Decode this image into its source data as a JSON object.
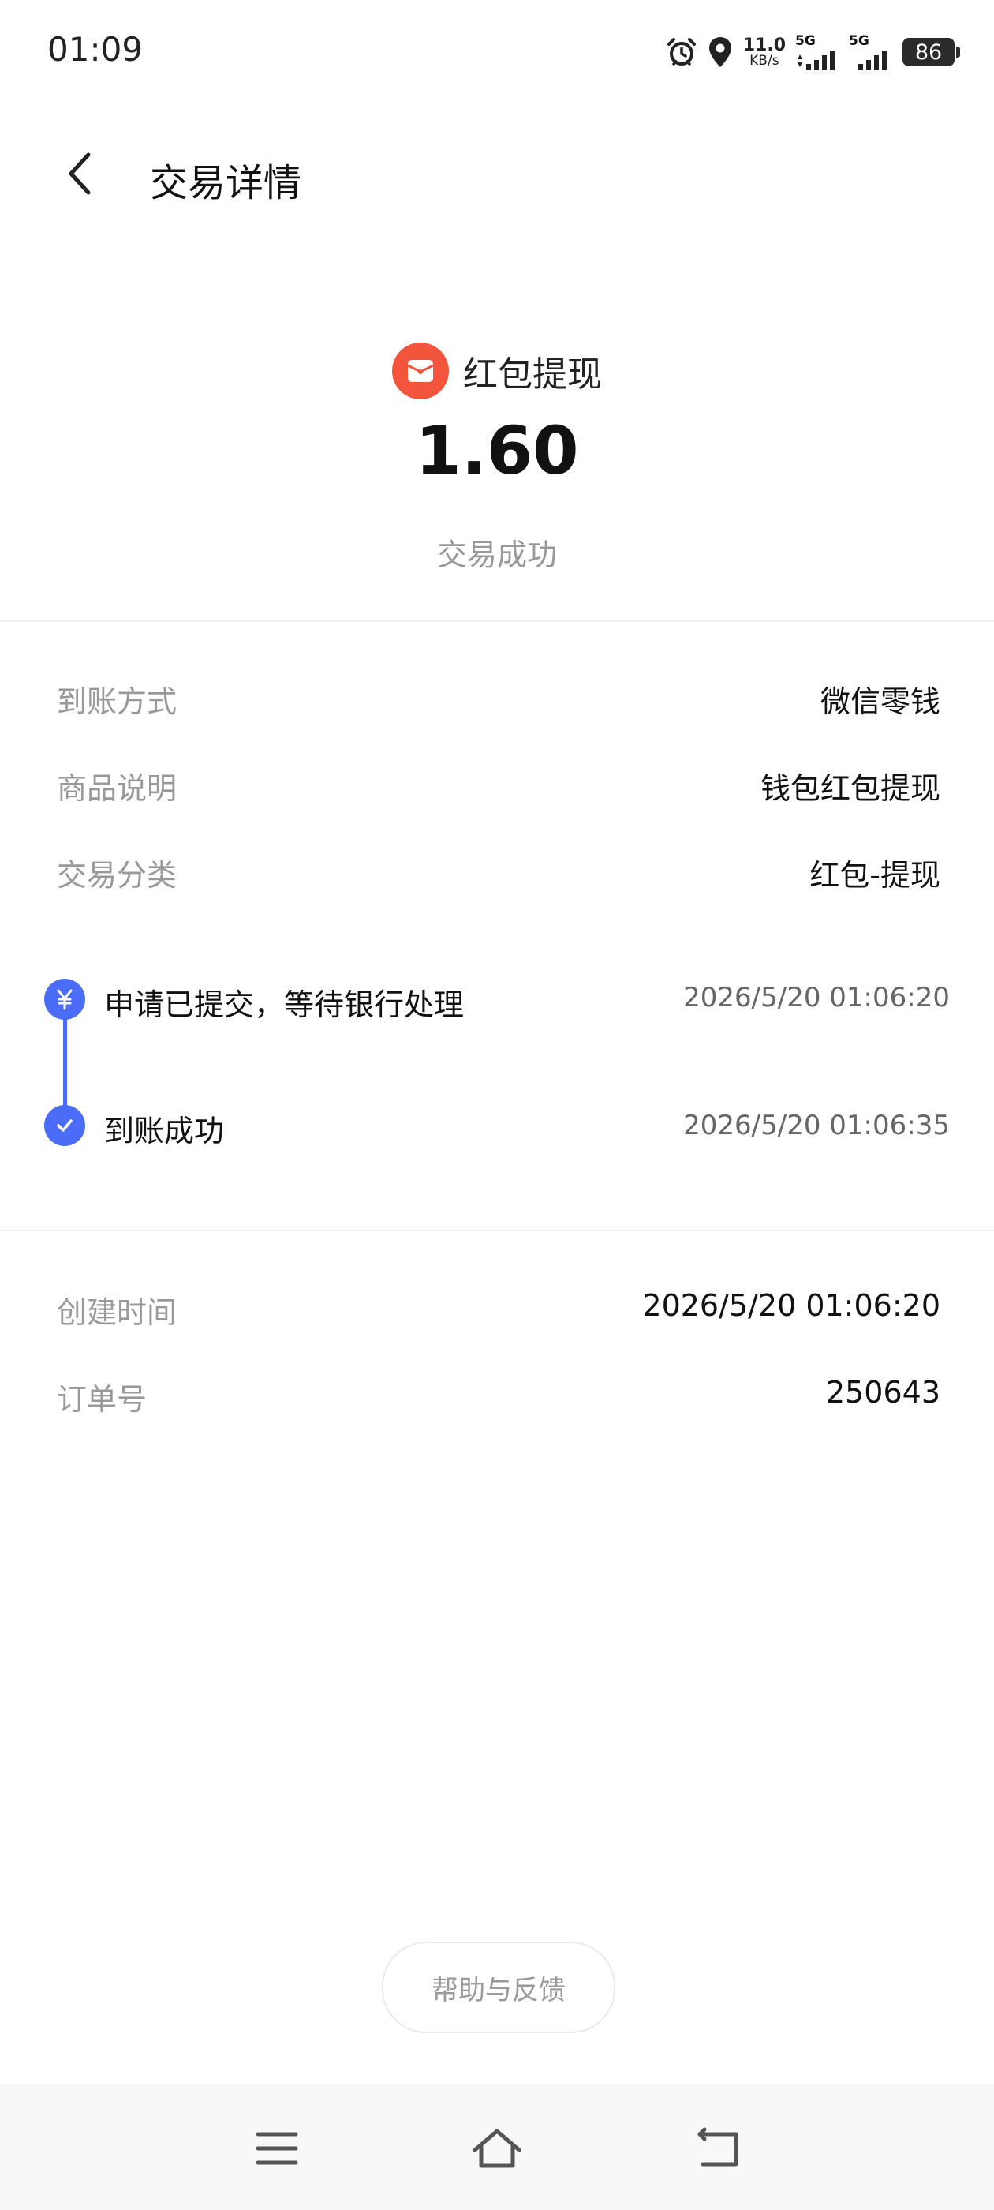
{
  "status_bar": {
    "time": "01:09",
    "net_speed_value": "11.0",
    "net_speed_unit": "KB/s",
    "signal1_label": "5G",
    "signal2_label": "5G",
    "battery": "86"
  },
  "header": {
    "title": "交易详情"
  },
  "summary": {
    "label": "红包提现",
    "amount": "1.60",
    "status": "交易成功"
  },
  "details": [
    {
      "label": "到账方式",
      "value": "微信零钱"
    },
    {
      "label": "商品说明",
      "value": "钱包红包提现"
    },
    {
      "label": "交易分类",
      "value": "红包-提现"
    }
  ],
  "timeline": [
    {
      "text": "申请已提交，等待银行处理",
      "time": "2026/5/20 01:06:20"
    },
    {
      "text": "到账成功",
      "time": "2026/5/20 01:06:35"
    }
  ],
  "order": [
    {
      "label": "创建时间",
      "value": "2026/5/20 01:06:20"
    },
    {
      "label": "订单号",
      "value": "250643"
    }
  ],
  "help_button": "帮助与反馈",
  "colors": {
    "accent_blue": "#4a6cf7",
    "red_packet": "#f2543c",
    "muted_text": "#999999"
  }
}
